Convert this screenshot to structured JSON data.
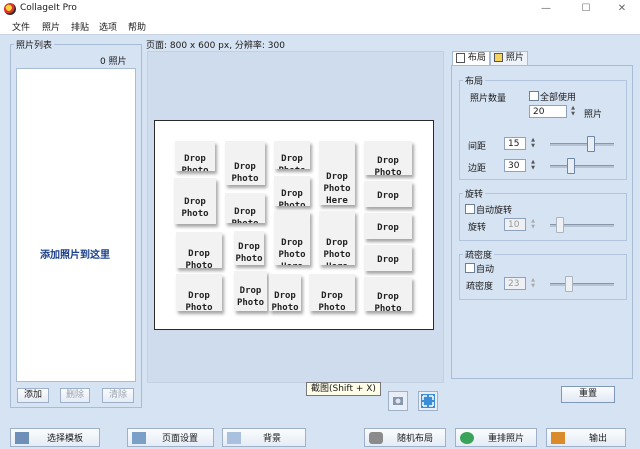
{
  "window": {
    "title": "CollageIt Pro",
    "minimize": "—",
    "maximize": "☐",
    "close": "✕"
  },
  "menu": [
    "文件",
    "照片",
    "排贴",
    "选项",
    "帮助"
  ],
  "photo_list": {
    "legend": "照片列表",
    "count": "0 照片",
    "drop_hint": "添加照片到这里",
    "add": "添加",
    "remove": "删除",
    "clear": "清除"
  },
  "page_info": "页面: 800 x 600 px, 分辨率: 300",
  "tile_texts": {
    "drop": "Drop",
    "photo": "Photo",
    "here": "Here"
  },
  "tooltip": "截图(Shift + X)",
  "right": {
    "tab_layout": "布局",
    "tab_photo": "照片",
    "layout_legend": "布局",
    "photo_count_label": "照片数量",
    "use_all": "全部使用",
    "count_value": "20",
    "count_unit": "照片",
    "spacing_label": "间距",
    "spacing_value": "15",
    "margin_label": "边距",
    "margin_value": "30",
    "rotation_legend": "旋转",
    "auto_rotate": "自动旋转",
    "rotate_label": "旋转",
    "rotate_value": "10",
    "density_legend": "疏密度",
    "auto": "自动",
    "density_label": "疏密度",
    "density_value": "23",
    "reset": "重置"
  },
  "bottom": {
    "select_template": "选择模板",
    "page_setup": "页面设置",
    "background": "背景",
    "random_layout": "随机布局",
    "rearrange": "重排照片",
    "output": "输出"
  },
  "colors": {
    "accent": "#1b3f8a",
    "panel": "#d6e3f3"
  }
}
